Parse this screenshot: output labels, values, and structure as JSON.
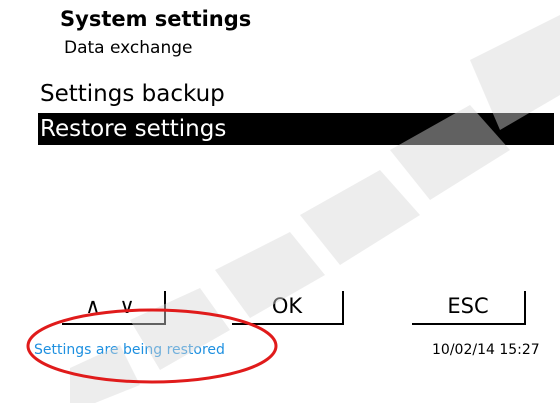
{
  "header": {
    "title": "System settings",
    "subtitle": "Data exchange"
  },
  "menu": {
    "items": [
      {
        "label": "Settings backup",
        "selected": false
      },
      {
        "label": "Restore settings",
        "selected": true
      }
    ]
  },
  "softkeys": {
    "updown_label": "∧ ∨",
    "ok_label": "OK",
    "esc_label": "ESC"
  },
  "status": {
    "message": "Settings are being restored",
    "message_color": "#1e90e0",
    "datetime": "10/02/14 15:27"
  },
  "annotation": {
    "color": "#e01b1b"
  },
  "colors": {
    "background": "#ffffff",
    "highlight": "#000000",
    "highlight_text": "#ffffff"
  }
}
